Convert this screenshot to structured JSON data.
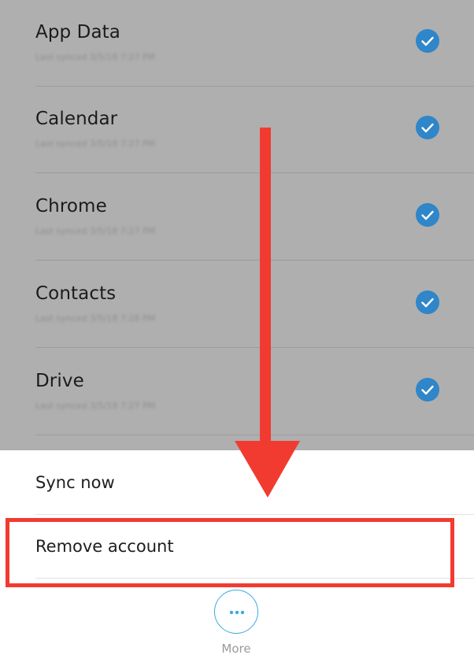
{
  "sync_items": [
    {
      "title": "App Data",
      "subtitle": "Last synced 3/5/18 7:27 PM",
      "icon": "check-circle-icon"
    },
    {
      "title": "Calendar",
      "subtitle": "Last synced 3/5/18 7:27 PM",
      "icon": "check-circle-icon"
    },
    {
      "title": "Chrome",
      "subtitle": "Last synced 3/5/18 7:27 PM",
      "icon": "check-circle-icon"
    },
    {
      "title": "Contacts",
      "subtitle": "Last synced 3/5/18 7:28 PM",
      "icon": "check-circle-icon"
    },
    {
      "title": "Drive",
      "subtitle": "Last synced 3/5/18 7:27 PM",
      "icon": "check-circle-icon"
    }
  ],
  "sheet": {
    "sync_now": "Sync now",
    "remove_account": "Remove account",
    "more_label": "More",
    "more_icon": "more-dots-icon"
  },
  "colors": {
    "accent": "#2f86c9",
    "highlight": "#f23b30",
    "scrim": "#afafaf"
  }
}
